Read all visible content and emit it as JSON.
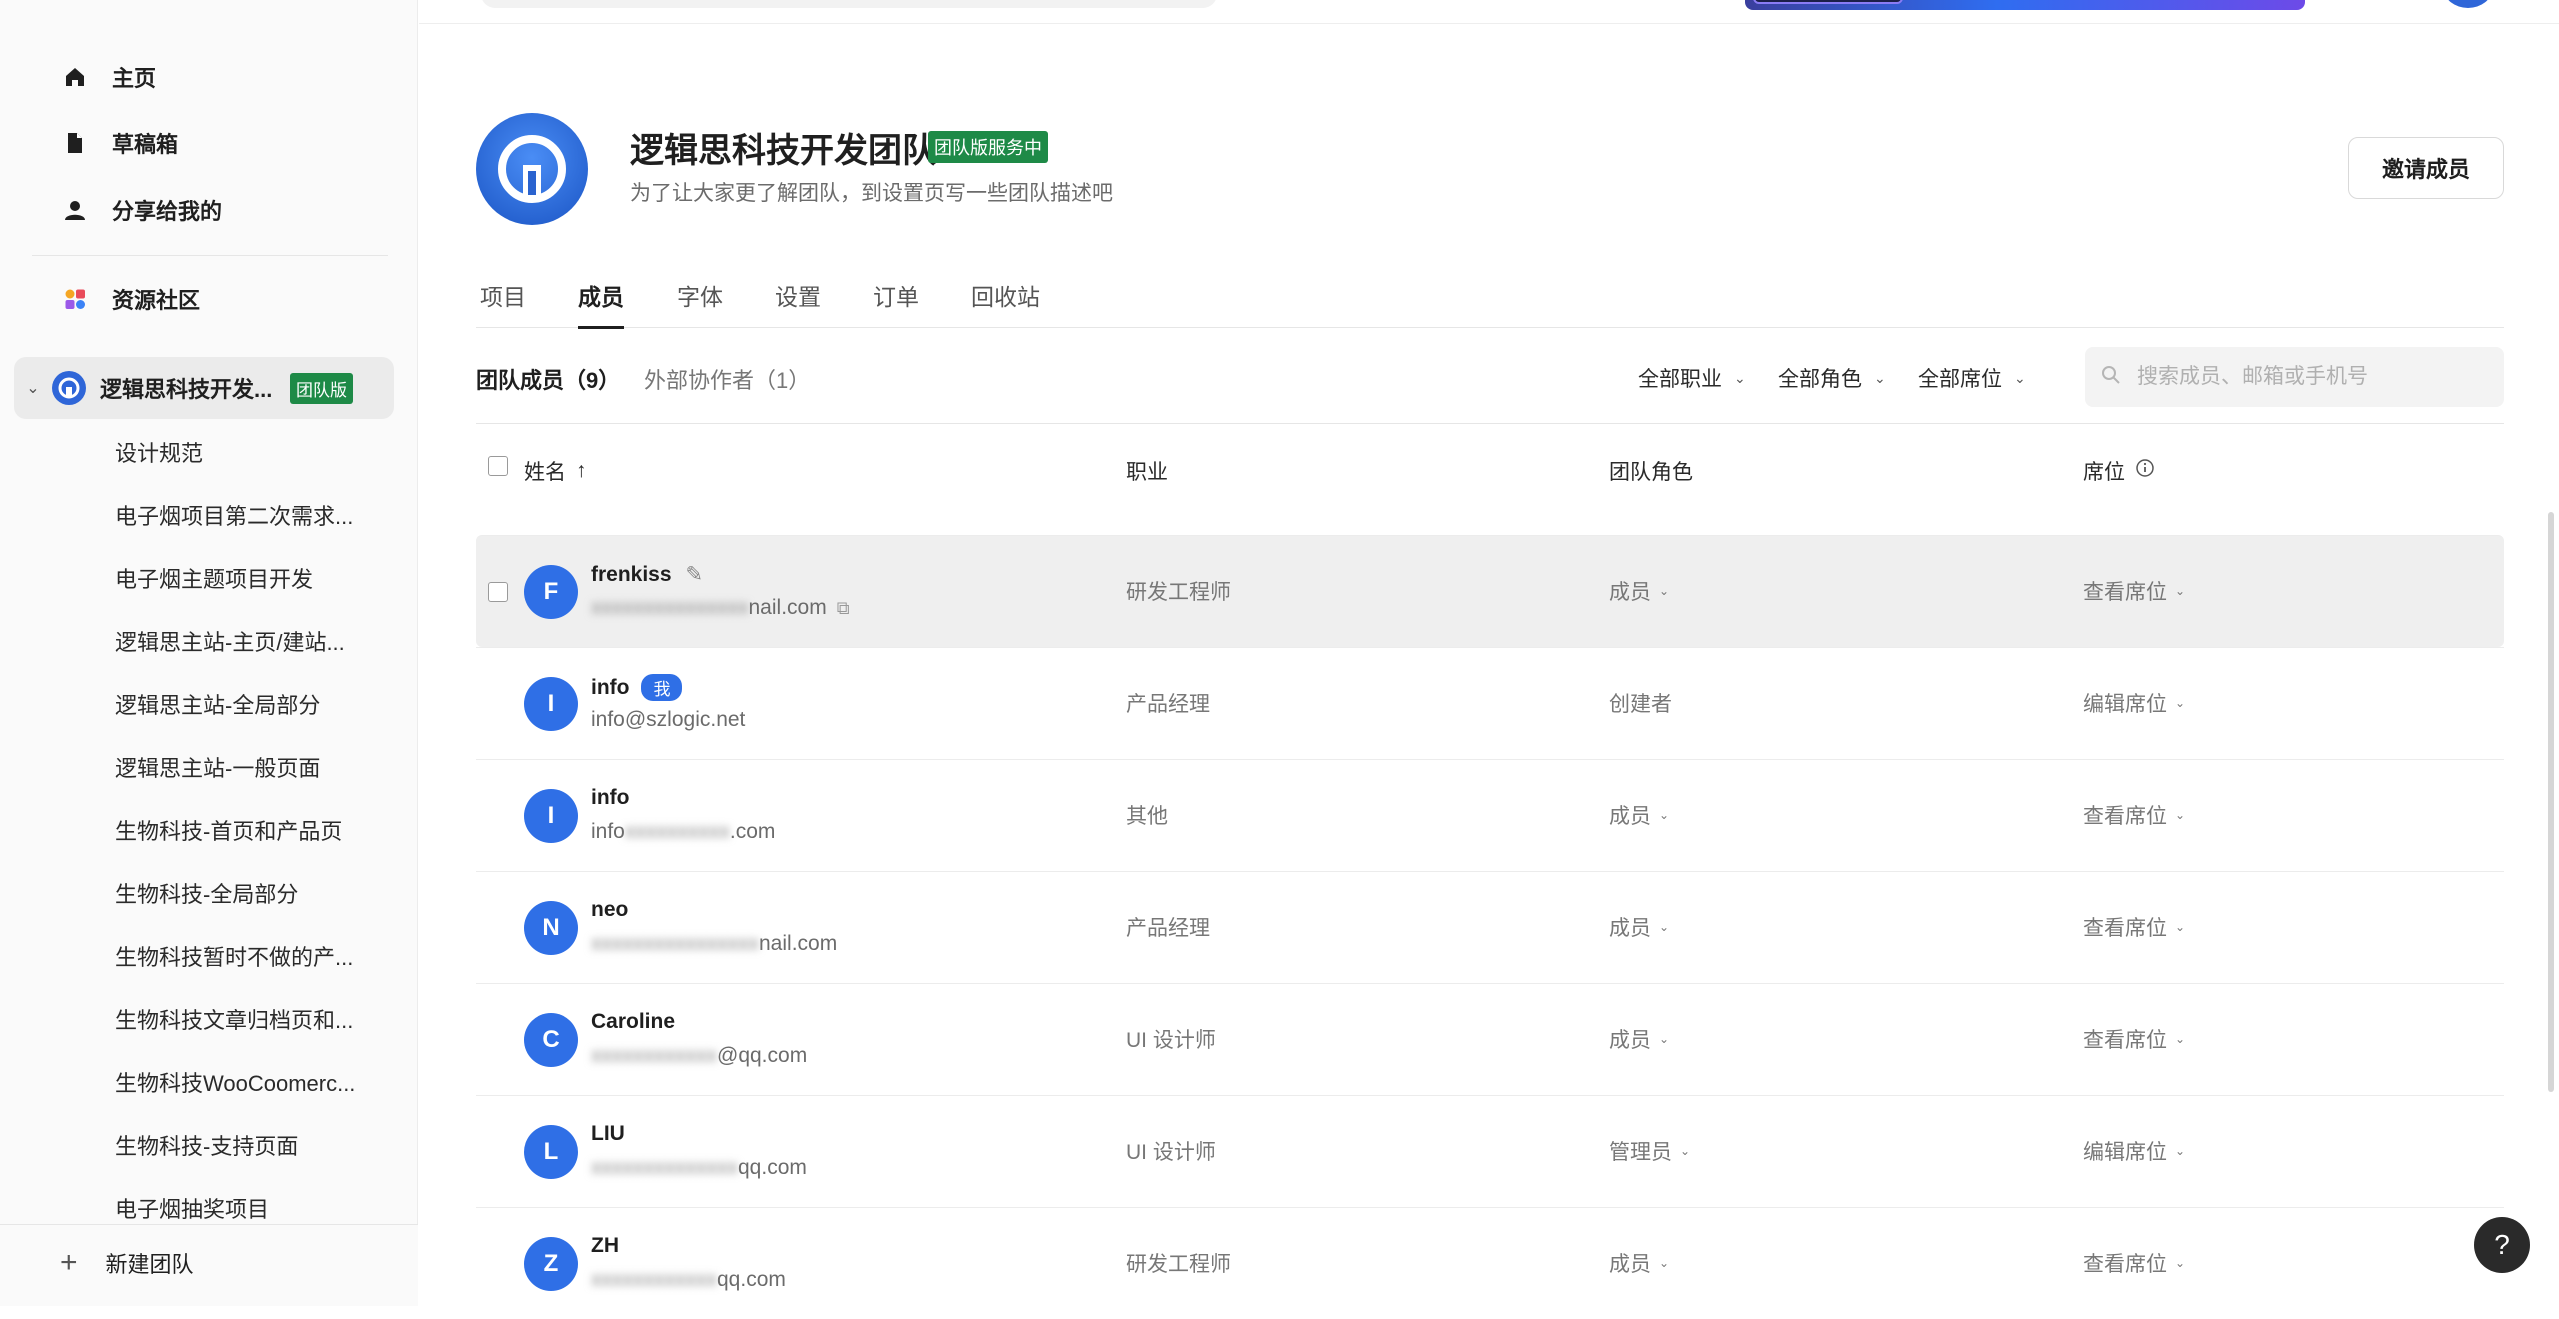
{
  "sidebar": {
    "nav": [
      {
        "label": "主页",
        "icon": "home-icon"
      },
      {
        "label": "草稿箱",
        "icon": "file-icon"
      },
      {
        "label": "分享给我的",
        "icon": "user-icon"
      },
      {
        "label": "资源社区",
        "icon": "community-icon"
      }
    ],
    "team": {
      "name": "逻辑思科技开发...",
      "badge": "团队版"
    },
    "projects": [
      "设计规范",
      "电子烟项目第二次需求...",
      "电子烟主题项目开发",
      "逻辑思主站-主页/建站...",
      "逻辑思主站-全局部分",
      "逻辑思主站-一般页面",
      "生物科技-首页和产品页",
      "生物科技-全局部分",
      "生物科技暂时不做的产...",
      "生物科技文章归档页和...",
      "生物科技WooCoomerc...",
      "生物科技-支持页面",
      "电子烟抽奖项目"
    ],
    "new_team": "新建团队"
  },
  "header": {
    "team_name": "逻辑思科技开发团队",
    "service_badge": "团队版服务中",
    "description": "为了让大家更了解团队，到设置页写一些团队描述吧",
    "invite_button": "邀请成员"
  },
  "tabs": [
    "项目",
    "成员",
    "字体",
    "设置",
    "订单",
    "回收站"
  ],
  "active_tab": "成员",
  "subtabs": {
    "members": "团队成员（9）",
    "external": "外部协作者（1）"
  },
  "filters": {
    "job": "全部职业",
    "role": "全部角色",
    "seat": "全部席位"
  },
  "search": {
    "placeholder": "搜索成员、邮箱或手机号"
  },
  "columns": {
    "name": "姓名",
    "job": "职业",
    "role": "团队角色",
    "seat": "席位"
  },
  "members": [
    {
      "initial": "F",
      "name": "frenkiss",
      "email_visible": "nail.com",
      "email_blurred": "xxxxxxxxxxxxxxx",
      "job": "研发工程师",
      "role": "成员",
      "seat": "查看席位",
      "me": false
    },
    {
      "initial": "I",
      "name": "info",
      "me_badge": "我",
      "email": "info@szlogic.net",
      "job": "产品经理",
      "role": "创建者",
      "seat": "编辑席位",
      "me": true
    },
    {
      "initial": "I",
      "name": "info",
      "email_prefix": "info",
      "email_blurred": "xxxxxxxxxx",
      "email_visible": ".com",
      "job": "其他",
      "role": "成员",
      "seat": "查看席位",
      "me": false
    },
    {
      "initial": "N",
      "name": "neo",
      "email_blurred": "xxxxxxxxxxxxxxxx",
      "email_visible": "nail.com",
      "job": "产品经理",
      "role": "成员",
      "seat": "查看席位",
      "me": false
    },
    {
      "initial": "C",
      "name": "Caroline",
      "email_blurred": "xxxxxxxxxxxx",
      "email_visible": "@qq.com",
      "job": "UI 设计师",
      "role": "成员",
      "seat": "查看席位",
      "me": false
    },
    {
      "initial": "L",
      "name": "LIU",
      "email_blurred": "xxxxxxxxxxxxxx",
      "email_visible": "qq.com",
      "job": "UI 设计师",
      "role": "管理员",
      "seat": "编辑席位",
      "me": false
    },
    {
      "initial": "Z",
      "name": "ZH",
      "email_blurred": "xxxxxxxxxxxx",
      "email_visible": "qq.com",
      "job": "研发工程师",
      "role": "成员",
      "seat": "查看席位",
      "me": false
    }
  ],
  "help": "?",
  "colors": {
    "accent": "#2f6fe6",
    "badge_green": "#1e8a47"
  }
}
